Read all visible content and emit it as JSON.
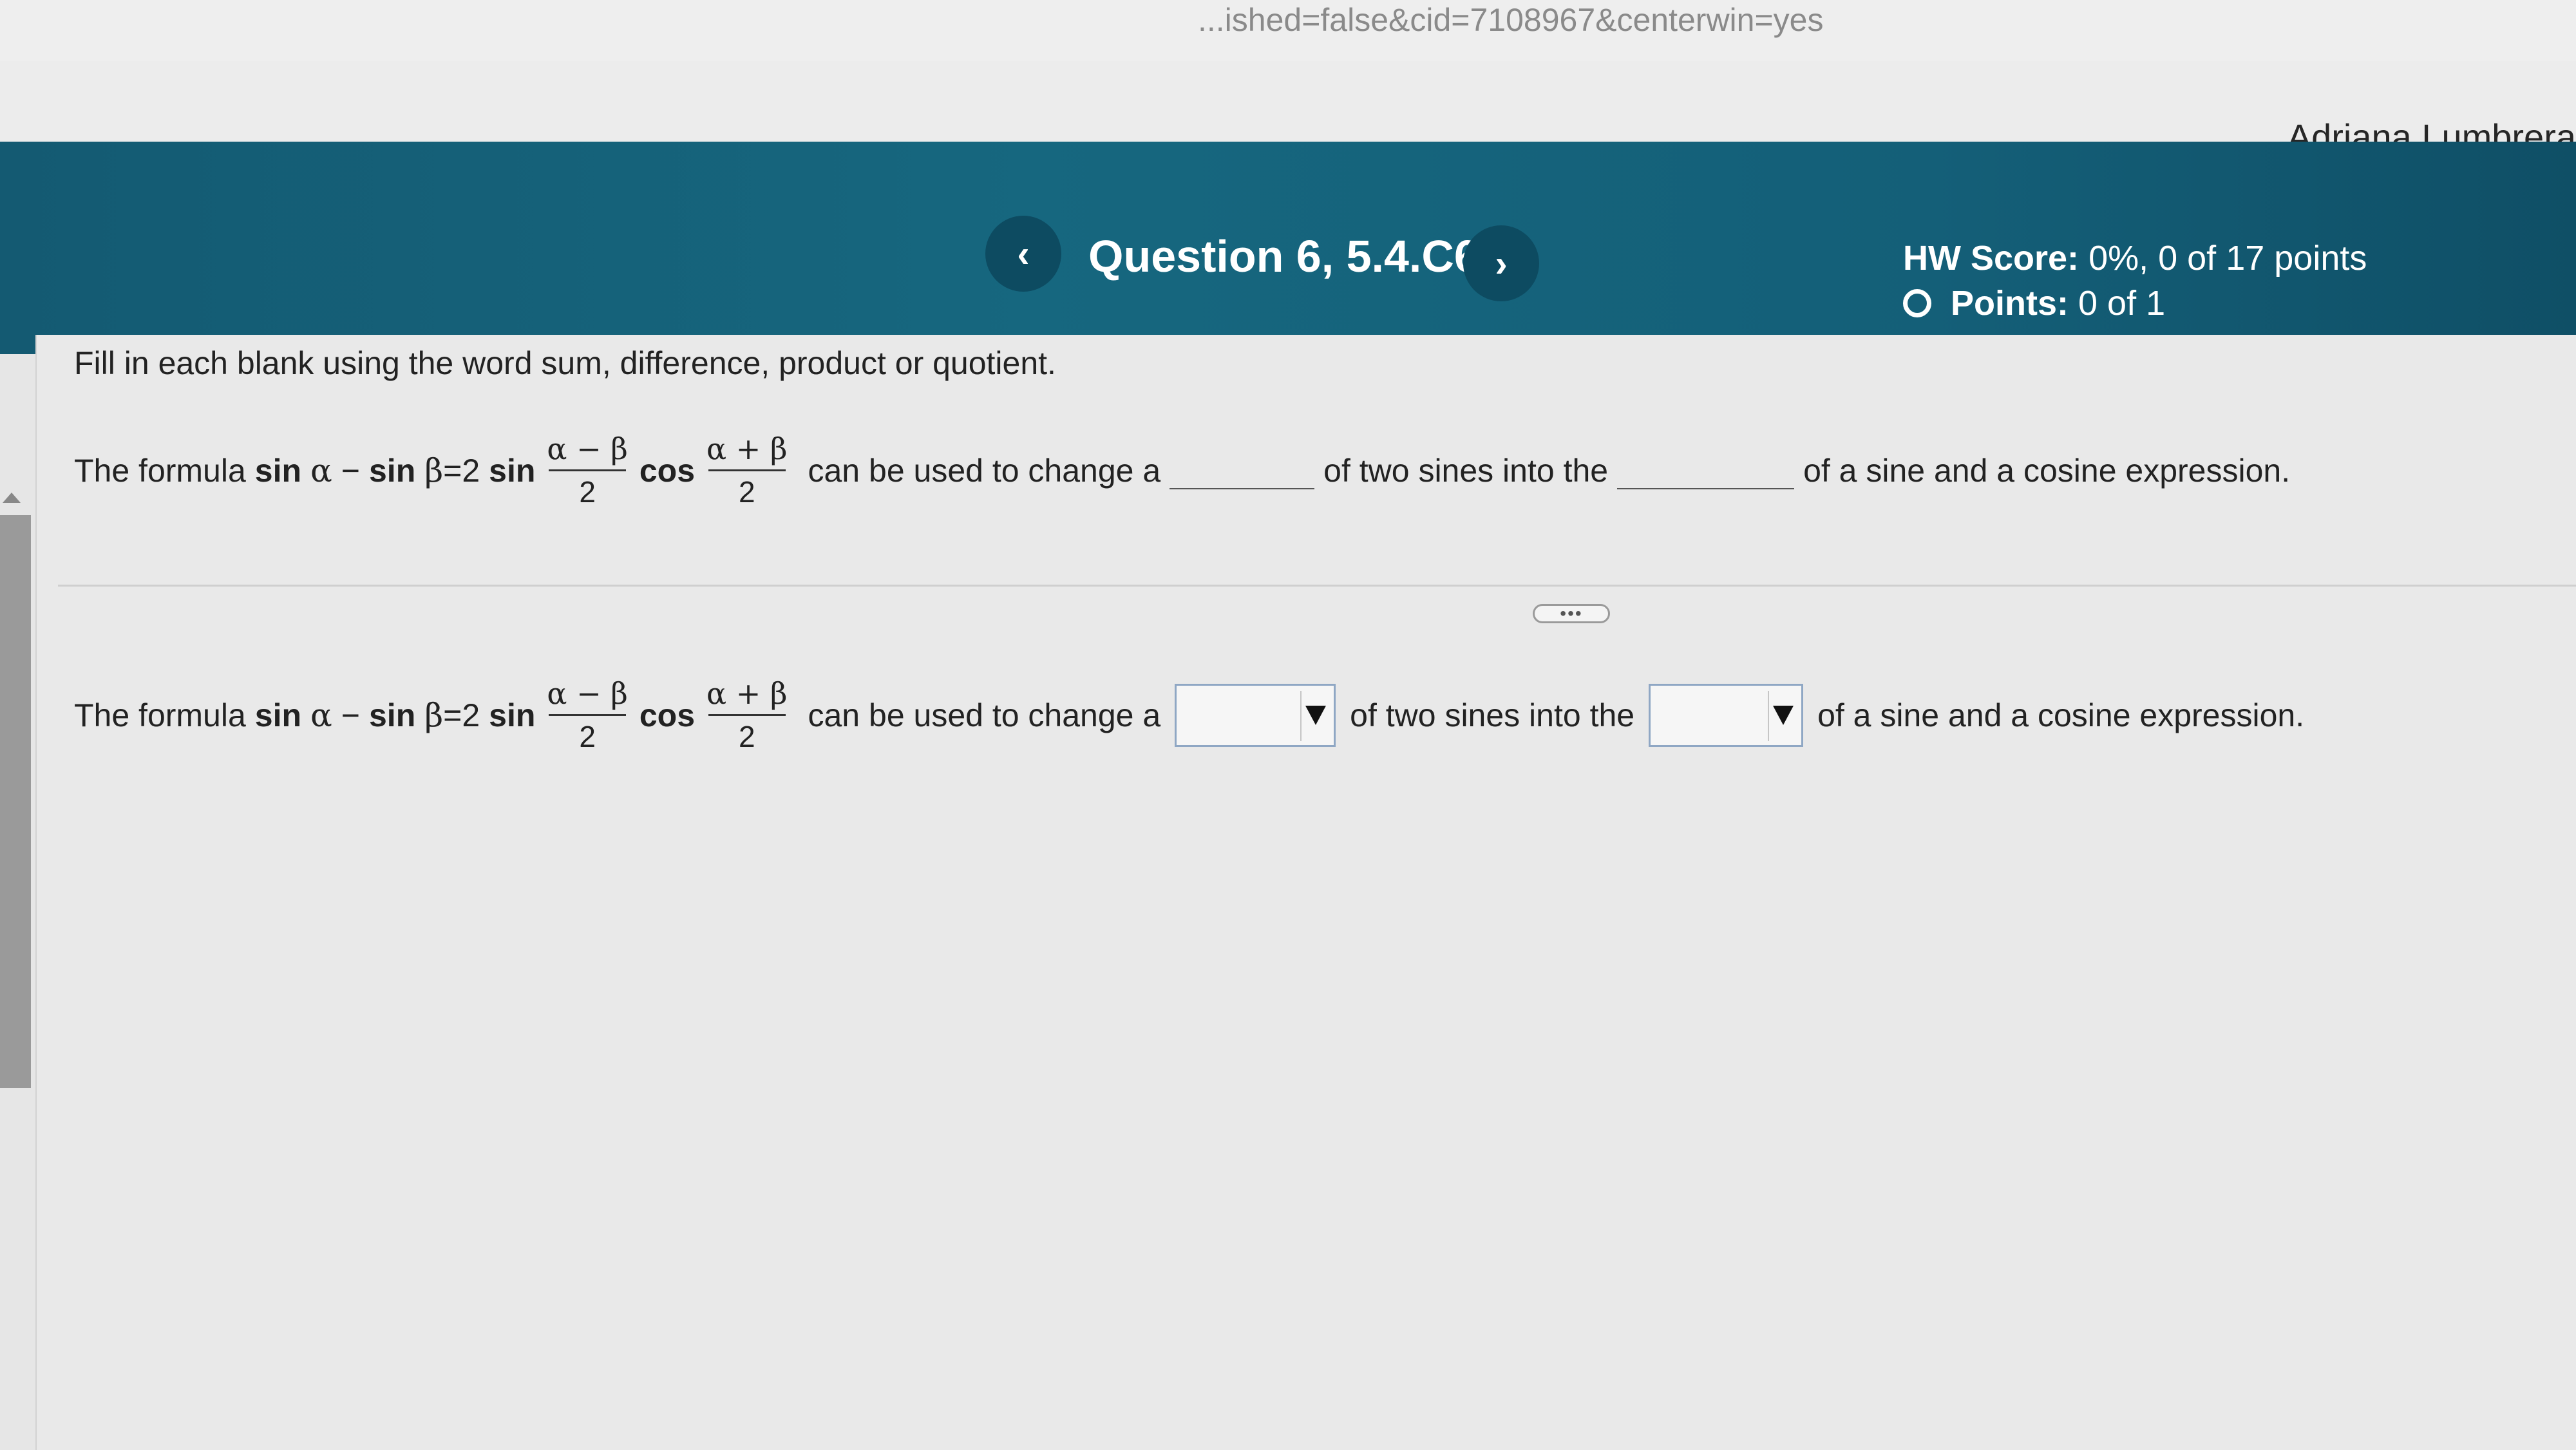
{
  "browser": {
    "url_fragment": "...ished=false&cid=7108967&centerwin=yes"
  },
  "user": {
    "name": "Adriana Lumbrera"
  },
  "header": {
    "prev_icon": "chevron-left-icon",
    "next_icon": "chevron-right-icon",
    "question_title": "Question 6, 5.4.C6",
    "hw_score_label": "HW Score:",
    "hw_score_value": "0%, 0 of 17 points",
    "points_label": "Points:",
    "points_value": "0 of 1"
  },
  "question": {
    "instruction": "Fill in each blank using the word sum, difference, product or quotient.",
    "formula": {
      "prefix": "The formula",
      "sin": "sin",
      "alpha": "α",
      "minus": "−",
      "beta": "β",
      "equals": "=2",
      "cos": "cos",
      "frac1_num": "α − β",
      "frac1_den": "2",
      "frac2_num": "α + β",
      "frac2_den": "2"
    },
    "text_change": "can be used to change a",
    "text_two_sines": "of two sines into the",
    "text_two_sines_answer": "of  two sines into the",
    "text_end": "of a sine and a cosine expression.",
    "dropdown1": {
      "selected": ""
    },
    "dropdown2": {
      "selected": ""
    },
    "separator_icon": "ellipsis-icon",
    "separator_text": "•••"
  },
  "colors": {
    "banner": "#16677f",
    "nav_button": "#0d4b61",
    "dropdown_border": "#8fa7c4"
  }
}
